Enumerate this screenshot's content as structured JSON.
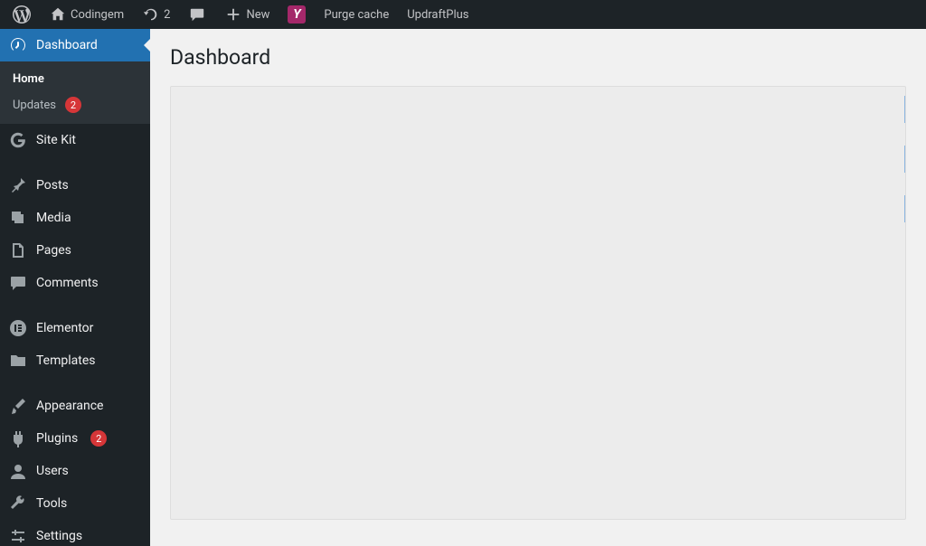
{
  "toolbar": {
    "site_name": "Codingem",
    "refresh_count": "2",
    "new_label": "New",
    "yoast_label": "Y",
    "purge_label": "Purge cache",
    "updraft_label": "UpdraftPlus"
  },
  "sidebar": {
    "dashboard": {
      "label": "Dashboard"
    },
    "submenu": {
      "home": "Home",
      "updates": "Updates",
      "updates_count": "2"
    },
    "sitekit": {
      "label": "Site Kit"
    },
    "posts": {
      "label": "Posts"
    },
    "media": {
      "label": "Media"
    },
    "pages": {
      "label": "Pages"
    },
    "comments": {
      "label": "Comments"
    },
    "elementor": {
      "label": "Elementor"
    },
    "templates": {
      "label": "Templates"
    },
    "appearance": {
      "label": "Appearance"
    },
    "plugins": {
      "label": "Plugins",
      "count": "2"
    },
    "users": {
      "label": "Users"
    },
    "tools": {
      "label": "Tools"
    },
    "settings": {
      "label": "Settings"
    }
  },
  "page": {
    "title": "Dashboard"
  }
}
